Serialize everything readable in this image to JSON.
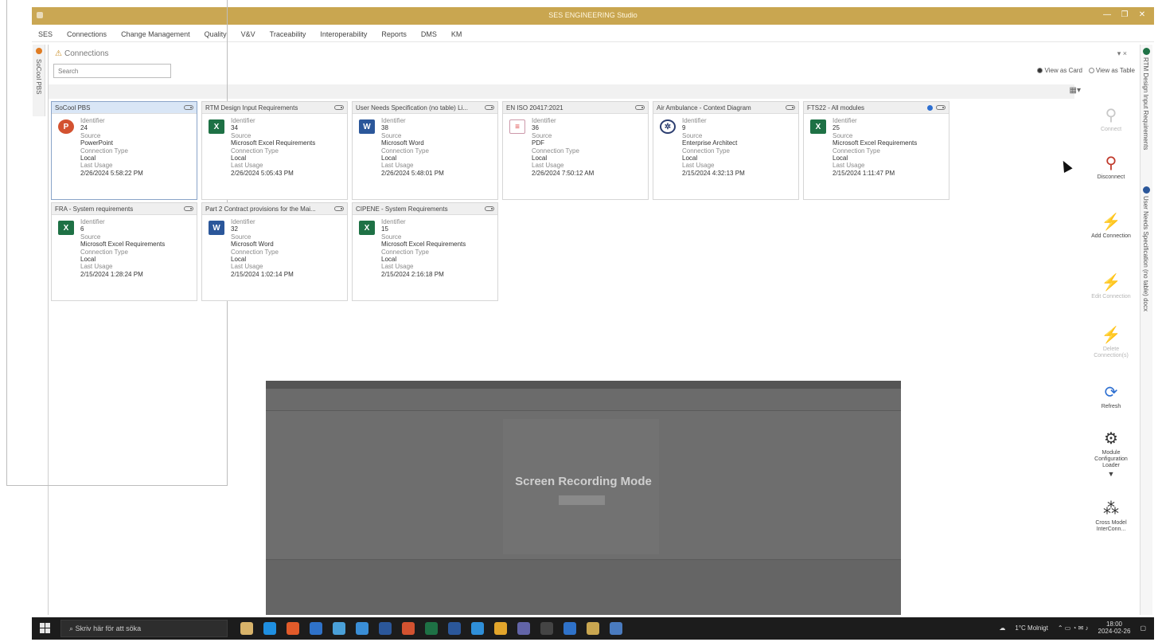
{
  "window": {
    "title": "SES ENGINEERING Studio",
    "controls": [
      "—",
      "❐",
      "✕"
    ]
  },
  "menu": [
    "SES",
    "Connections",
    "Change Management",
    "Quality",
    "V&V",
    "Traceability",
    "Interoperability",
    "Reports",
    "DMS",
    "KM"
  ],
  "left_tab": {
    "label": "SoCool PBS"
  },
  "panel": {
    "title": "Connections",
    "search_placeholder": "Search",
    "pin": "▾ ×",
    "view_card": "View as Card",
    "view_table": "View as Table",
    "view_toggle": "▦▾"
  },
  "field_labels": {
    "identifier": "Identifier",
    "source": "Source",
    "connection_type": "Connection Type",
    "last_usage": "Last Usage"
  },
  "cards": [
    {
      "name": "SoCool PBS",
      "identifier": "24",
      "source": "PowerPoint",
      "connection_type": "Local",
      "last_usage": "2/26/2024 5:58:22 PM",
      "icon": "powerpoint-icon"
    },
    {
      "name": "RTM Design Input Requirements",
      "identifier": "34",
      "source": "Microsoft Excel Requirements",
      "connection_type": "Local",
      "last_usage": "2/26/2024 5:05:43 PM",
      "icon": "excel-icon"
    },
    {
      "name": "User Needs Specification (no table) Li...",
      "identifier": "38",
      "source": "Microsoft Word",
      "connection_type": "Local",
      "last_usage": "2/26/2024 5:48:01 PM",
      "icon": "word-icon"
    },
    {
      "name": "EN ISO 20417:2021",
      "identifier": "36",
      "source": "PDF",
      "connection_type": "Local",
      "last_usage": "2/26/2024 7:50:12 AM",
      "icon": "pdf-icon"
    },
    {
      "name": "Air Ambulance - Context Diagram",
      "identifier": "9",
      "source": "Enterprise Architect",
      "connection_type": "Local",
      "last_usage": "2/15/2024 4:32:13 PM",
      "icon": "enterprise-architect-icon"
    },
    {
      "name": "FTS22 - All modules",
      "identifier": "25",
      "source": "Microsoft Excel Requirements",
      "connection_type": "Local",
      "last_usage": "2/15/2024 1:11:47 PM",
      "icon": "excel-icon"
    },
    {
      "name": "FRA - System requirements",
      "identifier": "6",
      "source": "Microsoft Excel Requirements",
      "connection_type": "Local",
      "last_usage": "2/15/2024 1:28:24 PM",
      "icon": "excel-icon"
    },
    {
      "name": "Part 2 Contract provisions for the Mai...",
      "identifier": "32",
      "source": "Microsoft Word",
      "connection_type": "Local",
      "last_usage": "2/15/2024 1:02:14 PM",
      "icon": "word-icon"
    },
    {
      "name": "CIPENE - System Requirements",
      "identifier": "15",
      "source": "Microsoft Excel Requirements",
      "connection_type": "Local",
      "last_usage": "2/15/2024 2:16:18 PM",
      "icon": "excel-icon"
    }
  ],
  "ribbon": [
    {
      "label": "Connect",
      "icon": "plug-icon",
      "glyph": "⚲"
    },
    {
      "label": "Disconnect",
      "icon": "unplug-icon",
      "glyph": "⚲"
    },
    {
      "label": "Add Connection",
      "icon": "add-connection-icon",
      "glyph": "⚡"
    },
    {
      "label": "Edit Connection",
      "icon": "edit-connection-icon",
      "glyph": "⚡"
    },
    {
      "label": "Delete Connection(s)",
      "icon": "delete-connection-icon",
      "glyph": "⚡"
    },
    {
      "label": "Refresh",
      "icon": "refresh-icon",
      "glyph": "⟳"
    },
    {
      "label": "Module Configuration Loader",
      "icon": "gear-icon",
      "glyph": "⚙"
    },
    {
      "label": "Cross Model InterConn...",
      "icon": "cross-model-icon",
      "glyph": "⁂"
    }
  ],
  "right_tabs": [
    "RTM Design Input Requirements",
    "User Needs Specification (no table) docx"
  ],
  "recording": {
    "label": "Screen Recording Mode"
  },
  "taskbar": {
    "search_placeholder": "Skriv här för att söka",
    "weather": "1°C Molnigt",
    "time": "18:00",
    "date": "2024-02-26"
  }
}
